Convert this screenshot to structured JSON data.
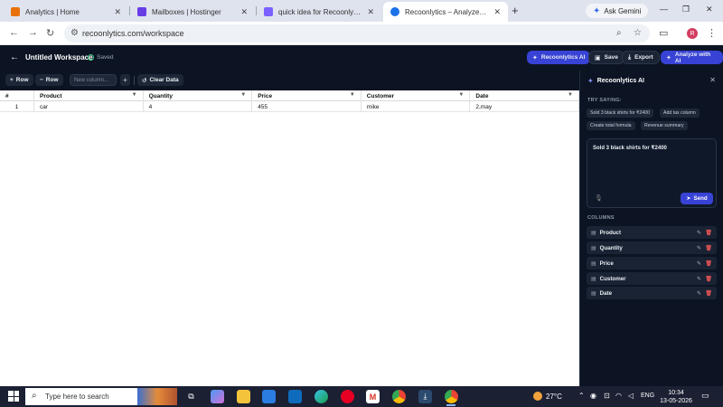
{
  "browser": {
    "tabs": [
      {
        "title": "Analytics | Home",
        "color": "#e8710a"
      },
      {
        "title": "Mailboxes | Hostinger",
        "color": "#673de6"
      },
      {
        "title": "quick idea for Recoonlytics - co",
        "color": "#7b61ff"
      },
      {
        "title": "Recoonlytics – Analyze, Clean &",
        "color": "#1a73e8"
      }
    ],
    "tab_close": "✕",
    "new_tab": "+",
    "gemini_label": "Ask Gemini",
    "url": "recoonlytics.com/workspace",
    "profile_initial": "R"
  },
  "app": {
    "workspace_title": "Untitled Workspace",
    "saved_status": "Saved",
    "header_buttons": {
      "ai": "Recoonlytics AI",
      "save": "Save",
      "export": "Export",
      "analyze": "Analyze with AI"
    },
    "toolbar": {
      "add_row": "Row",
      "remove_row": "Row",
      "new_column_placeholder": "New column...",
      "add_column": "+",
      "clear_data": "Clear Data"
    },
    "table": {
      "index_header": "#",
      "columns": [
        "Product",
        "Quantity",
        "Price",
        "Customer",
        "Date"
      ],
      "rows": [
        {
          "index": "1",
          "cells": [
            "car",
            "4",
            "455",
            "mike",
            "2,may"
          ]
        }
      ]
    },
    "panel": {
      "title": "Recoonlytics AI",
      "try_saying_label": "TRY SAYING:",
      "suggestions": [
        "Sold 3 black shirts for ₹2400",
        "Add tax column",
        "Create total formula",
        "Revenue summary"
      ],
      "prompt_text": "Sold 3 black shirts for ₹2400",
      "send_label": "Send",
      "columns_label": "COLUMNS",
      "columns": [
        "Product",
        "Quantity",
        "Price",
        "Customer",
        "Date"
      ]
    }
  },
  "taskbar": {
    "search_placeholder": "Type here to search",
    "temperature": "27°C",
    "language": "ENG",
    "time": "10:34",
    "date": "13-05-2026"
  }
}
